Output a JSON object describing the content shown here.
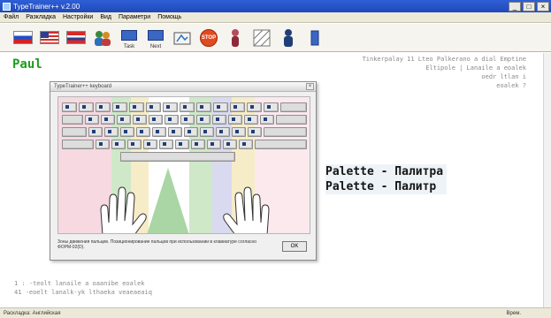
{
  "window": {
    "title": "TypeTrainer++ v.2.00"
  },
  "menu": [
    "Файл",
    "Разкладка",
    "Настройки",
    "Вид",
    "Параметри",
    "Помощь"
  ],
  "toolbar": {
    "items": [
      {
        "name": "flag-ru-icon"
      },
      {
        "name": "flag-us-icon"
      },
      {
        "name": "flag-mix-icon"
      },
      {
        "name": "users-icon"
      },
      {
        "name": "task-icon",
        "label": "Task"
      },
      {
        "name": "next-icon",
        "label": "Next"
      },
      {
        "name": "keyboard-icon"
      },
      {
        "name": "stop-icon",
        "label": "STOP"
      },
      {
        "name": "person-icon"
      },
      {
        "name": "hatch-icon"
      },
      {
        "name": "figure-icon"
      },
      {
        "name": "bookmark-icon"
      }
    ]
  },
  "main": {
    "user": "Paul",
    "text_lines": [
      "Tinkerpalay 11 Lteo Palkerano a dial Emptine",
      "Eltipole | Lanaile a eoalek",
      "oedr ltlan i",
      "eoalek ?"
    ],
    "practice": {
      "line1": "Palette - Палитра",
      "line2": "Palette - Палитр"
    },
    "bottom_lines": [
      "1   : -teolt lanaile a oaanibe eoalek",
      "41      -eoelt lanalk-yk lthaeka veaeaeaiq"
    ]
  },
  "dialog": {
    "title": "TypeTrainer++ keyboard",
    "footer": "Зоны движения пальцев. Позиционирование пальцев при использовании в клавиатуре согласно ФОРМ-02(D).",
    "ok": "OK",
    "zone_colors": [
      "#f9d7e0",
      "#cde6c6",
      "#d7d7f0",
      "#f6ecc8",
      "#f9d7e0"
    ]
  },
  "status": {
    "left": "Раскладка: Английская",
    "right": "Врем."
  }
}
